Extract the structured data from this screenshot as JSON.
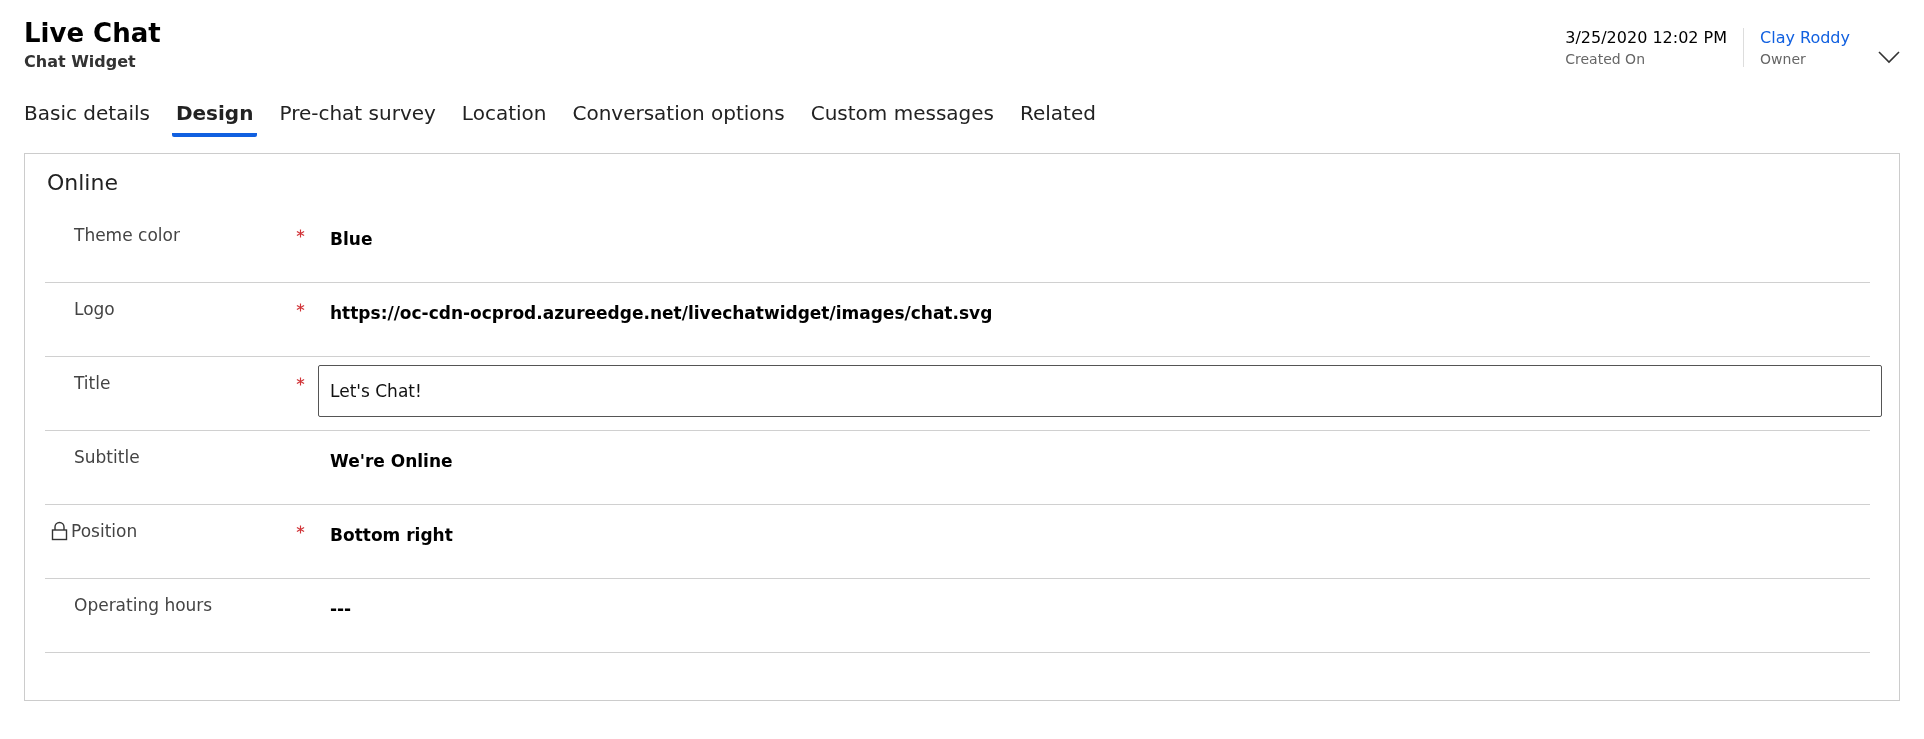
{
  "header": {
    "title": "Live Chat",
    "subtitle": "Chat Widget",
    "created_on": {
      "value": "3/25/2020 12:02 PM",
      "label": "Created On"
    },
    "owner": {
      "value": "Clay Roddy",
      "label": "Owner"
    }
  },
  "tabs": [
    {
      "label": "Basic details",
      "selected": false
    },
    {
      "label": "Design",
      "selected": true
    },
    {
      "label": "Pre-chat survey",
      "selected": false
    },
    {
      "label": "Location",
      "selected": false
    },
    {
      "label": "Conversation options",
      "selected": false
    },
    {
      "label": "Custom messages",
      "selected": false
    },
    {
      "label": "Related",
      "selected": false
    }
  ],
  "section": {
    "title": "Online",
    "fields": [
      {
        "label": "Theme color",
        "required": true,
        "locked": false,
        "kind": "text",
        "value": "Blue"
      },
      {
        "label": "Logo",
        "required": true,
        "locked": false,
        "kind": "text",
        "value": "https://oc-cdn-ocprod.azureedge.net/livechatwidget/images/chat.svg"
      },
      {
        "label": "Title",
        "required": true,
        "locked": false,
        "kind": "input",
        "value": "Let's Chat!"
      },
      {
        "label": "Subtitle",
        "required": false,
        "locked": false,
        "kind": "text",
        "value": "We're Online"
      },
      {
        "label": "Position",
        "required": true,
        "locked": true,
        "kind": "text",
        "value": "Bottom right"
      },
      {
        "label": "Operating hours",
        "required": false,
        "locked": false,
        "kind": "text",
        "value": "---"
      }
    ]
  }
}
